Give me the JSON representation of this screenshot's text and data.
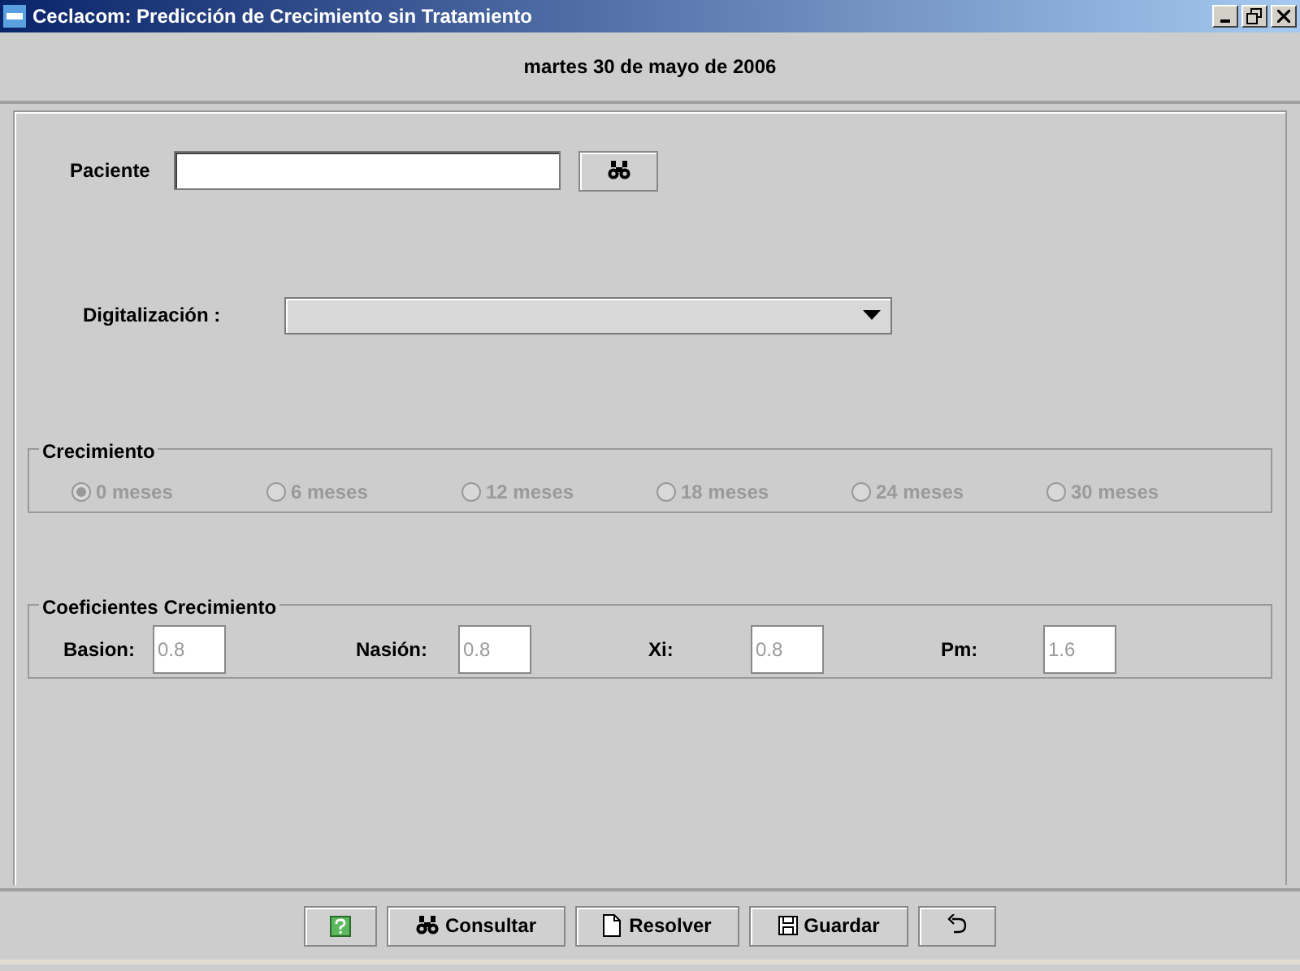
{
  "window": {
    "title": "Ceclacom: Predicción de Crecimiento sin Tratamiento"
  },
  "date": "martes 30 de mayo de 2006",
  "patient": {
    "label": "Paciente"
  },
  "digitization": {
    "label": "Digitalización :"
  },
  "growth": {
    "title": "Crecimiento",
    "options": [
      {
        "label": "0 meses",
        "selected": true,
        "disabled": true
      },
      {
        "label": "6 meses",
        "selected": false,
        "disabled": true
      },
      {
        "label": "12 meses",
        "selected": false,
        "disabled": true
      },
      {
        "label": "18 meses",
        "selected": false,
        "disabled": true
      },
      {
        "label": "24 meses",
        "selected": false,
        "disabled": true
      },
      {
        "label": "30 meses",
        "selected": false,
        "disabled": true
      }
    ]
  },
  "coefficients": {
    "title": "Coeficientes Crecimiento",
    "fields": [
      {
        "label": "Basion:",
        "value": "0.8",
        "disabled": true
      },
      {
        "label": "Nasión:",
        "value": "0.8",
        "disabled": true
      },
      {
        "label": "Xi:",
        "value": "0.8",
        "disabled": true
      },
      {
        "label": "Pm:",
        "value": "1.6",
        "disabled": true
      }
    ]
  },
  "buttons": [
    {
      "kind": "help"
    },
    {
      "kind": "search",
      "label": "Consultar"
    },
    {
      "kind": "solve",
      "label": "Resolver"
    },
    {
      "kind": "save",
      "label": "Guardar"
    },
    {
      "kind": "undo"
    }
  ]
}
